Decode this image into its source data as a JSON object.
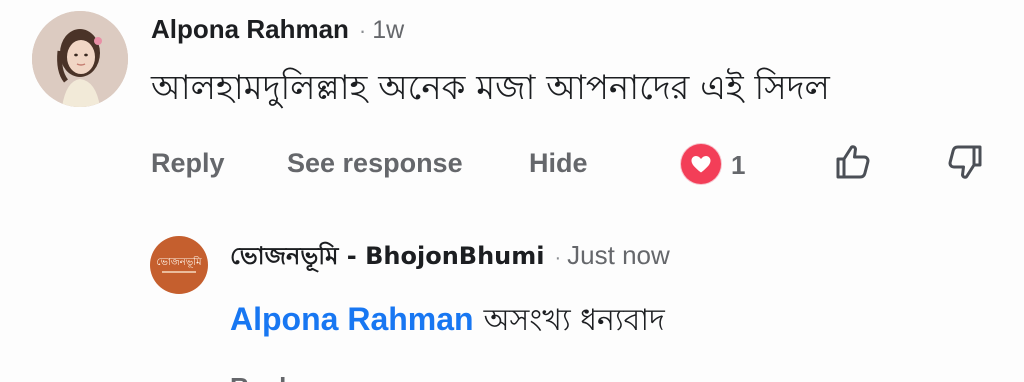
{
  "comment": {
    "author": "Alpona Rahman",
    "separator": "·",
    "time": "1w",
    "text": "আলহামদুলিল্লাহ অনেক মজা আপনাদের এই সিদল",
    "actions": {
      "reply": "Reply",
      "see_response": "See response",
      "hide": "Hide"
    },
    "reaction": {
      "icon": "heart-icon",
      "count": "1",
      "color": "#f33e58"
    },
    "icons": {
      "like": "thumbs-up-icon",
      "dislike": "thumbs-down-icon"
    }
  },
  "reply": {
    "author": "ভোজনভূমি - BhojonBhumi",
    "separator": "·",
    "time": "Just now",
    "mention": "Alpona Rahman",
    "text": "অসংখ্য ধন্যবাদ",
    "avatar_color": "#c55f2e",
    "mention_color": "#1877f2",
    "next_action_partial": "Reply"
  }
}
